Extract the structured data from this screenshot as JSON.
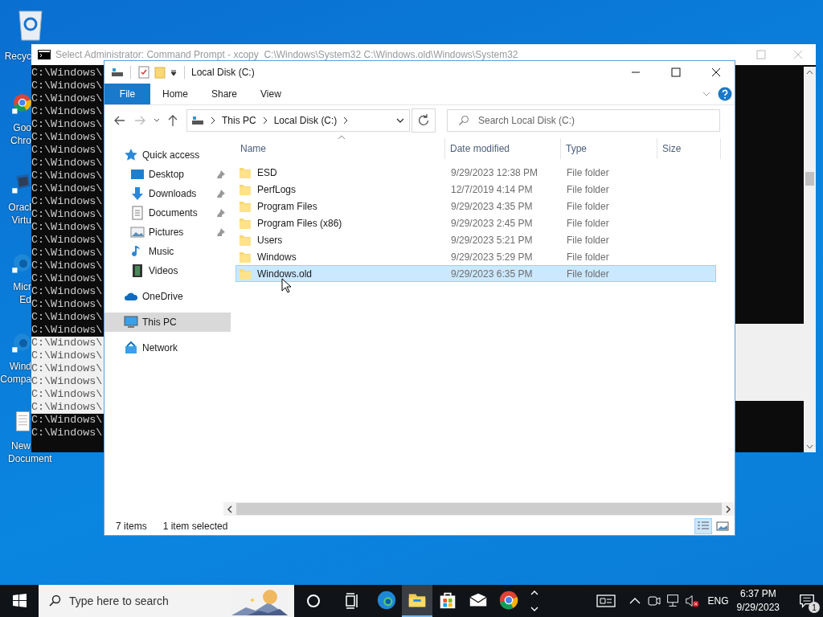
{
  "desktop_icons": [
    {
      "kind": "recycle",
      "lines": [
        "Recyc"
      ]
    },
    {
      "kind": "chrome",
      "lines": [
        "Goo",
        "Chro"
      ]
    },
    {
      "kind": "box",
      "lines": [
        "Oracl",
        "Virtu"
      ]
    },
    {
      "kind": "edge",
      "lines": [
        "Micr",
        "Ed"
      ]
    },
    {
      "kind": "edge",
      "lines": [
        "Wind",
        "Compa"
      ]
    },
    {
      "kind": "textfile",
      "lines": [
        "New",
        "Document"
      ]
    }
  ],
  "cmd": {
    "title": "Select Administrator: Command Prompt - xcopy  C:\\Windows\\System32 C:\\Windows.old\\Windows\\System32",
    "lines": [
      {
        "text": "C:\\Windows\\",
        "selected": false
      },
      {
        "text": "C:\\Windows\\",
        "selected": false
      },
      {
        "text": "C:\\Windows\\",
        "selected": false
      },
      {
        "text": "C:\\Windows\\",
        "selected": false
      },
      {
        "text": "C:\\Windows\\",
        "selected": false
      },
      {
        "text": "C:\\Windows\\",
        "selected": false
      },
      {
        "text": "C:\\Windows\\",
        "selected": false
      },
      {
        "text": "C:\\Windows\\",
        "selected": false
      },
      {
        "text": "C:\\Windows\\",
        "selected": false
      },
      {
        "text": "C:\\Windows\\",
        "selected": false
      },
      {
        "text": "C:\\Windows\\",
        "selected": false
      },
      {
        "text": "C:\\Windows\\",
        "selected": false
      },
      {
        "text": "C:\\Windows\\",
        "selected": false
      },
      {
        "text": "C:\\Windows\\",
        "selected": false
      },
      {
        "text": "C:\\Windows\\",
        "selected": false
      },
      {
        "text": "C:\\Windows\\",
        "selected": false
      },
      {
        "text": "C:\\Windows\\",
        "selected": false
      },
      {
        "text": "C:\\Windows\\",
        "selected": false
      },
      {
        "text": "C:\\Windows\\",
        "selected": false
      },
      {
        "text": "C:\\Windows\\",
        "selected": false
      },
      {
        "text": "C:\\Windows\\",
        "selected": false
      },
      {
        "text": "C:\\Windows\\",
        "selected": true
      },
      {
        "text": "C:\\Windows\\",
        "selected": true
      },
      {
        "text": "C:\\Windows\\",
        "selected": true
      },
      {
        "text": "C:\\Windows\\",
        "selected": true
      },
      {
        "text": "C:\\Windows\\",
        "selected": true
      },
      {
        "text": "C:\\Windows\\",
        "selected": true
      },
      {
        "text": "C:\\Windows\\",
        "selected": false
      },
      {
        "text": "C:\\Windows\\",
        "selected": false
      }
    ]
  },
  "explorer": {
    "title": "Local Disk (C:)",
    "ribbon_tabs": [
      {
        "label": "File",
        "kind": "file"
      },
      {
        "label": "Home",
        "kind": "tab"
      },
      {
        "label": "Share",
        "kind": "tab"
      },
      {
        "label": "View",
        "kind": "tab"
      }
    ],
    "address": {
      "crumbs": [
        "This PC",
        "Local Disk (C:)"
      ]
    },
    "search": {
      "placeholder": "Search Local Disk (C:)"
    },
    "nav": [
      {
        "label": "Quick access",
        "kind": "star",
        "selected": false,
        "children": [
          {
            "label": "Desktop",
            "kind": "desktop",
            "pinned": true,
            "selected": false
          },
          {
            "label": "Downloads",
            "kind": "download",
            "pinned": true,
            "selected": false
          },
          {
            "label": "Documents",
            "kind": "document",
            "pinned": true,
            "selected": false
          },
          {
            "label": "Pictures",
            "kind": "pictures",
            "pinned": true,
            "selected": false
          },
          {
            "label": "Music",
            "kind": "music",
            "pinned": false,
            "selected": false
          },
          {
            "label": "Videos",
            "kind": "videos",
            "pinned": false,
            "selected": false
          }
        ]
      },
      {
        "label": "OneDrive",
        "kind": "cloud",
        "selected": false
      },
      {
        "label": "This PC",
        "kind": "pc",
        "selected": true
      },
      {
        "label": "Network",
        "kind": "network",
        "selected": false
      }
    ],
    "columns": [
      "Name",
      "Date modified",
      "Type",
      "Size"
    ],
    "rows": [
      {
        "name": "ESD",
        "date": "9/29/2023 12:38 PM",
        "type": "File folder",
        "selected": false
      },
      {
        "name": "PerfLogs",
        "date": "12/7/2019 4:14 PM",
        "type": "File folder",
        "selected": false
      },
      {
        "name": "Program Files",
        "date": "9/29/2023 4:35 PM",
        "type": "File folder",
        "selected": false
      },
      {
        "name": "Program Files (x86)",
        "date": "9/29/2023 2:45 PM",
        "type": "File folder",
        "selected": false
      },
      {
        "name": "Users",
        "date": "9/29/2023 5:21 PM",
        "type": "File folder",
        "selected": false
      },
      {
        "name": "Windows",
        "date": "9/29/2023 5:29 PM",
        "type": "File folder",
        "selected": false
      },
      {
        "name": "Windows.old",
        "date": "9/29/2023 6:35 PM",
        "type": "File folder",
        "selected": true
      }
    ],
    "status": {
      "count": "7 items",
      "selection": "1 item selected"
    },
    "views": [
      {
        "kind": "details",
        "selected": true
      },
      {
        "kind": "large",
        "selected": false
      }
    ]
  },
  "taskbar": {
    "search": {
      "placeholder": "Type here to search"
    },
    "apps": [
      {
        "kind": "edge",
        "active": false
      },
      {
        "kind": "explorer",
        "active": true
      },
      {
        "kind": "store",
        "active": false
      },
      {
        "kind": "mail",
        "active": false
      },
      {
        "kind": "chrome",
        "active": false
      }
    ],
    "language": "ENG",
    "time": "6:37 PM",
    "date": "9/29/2023",
    "notifications": "1"
  }
}
